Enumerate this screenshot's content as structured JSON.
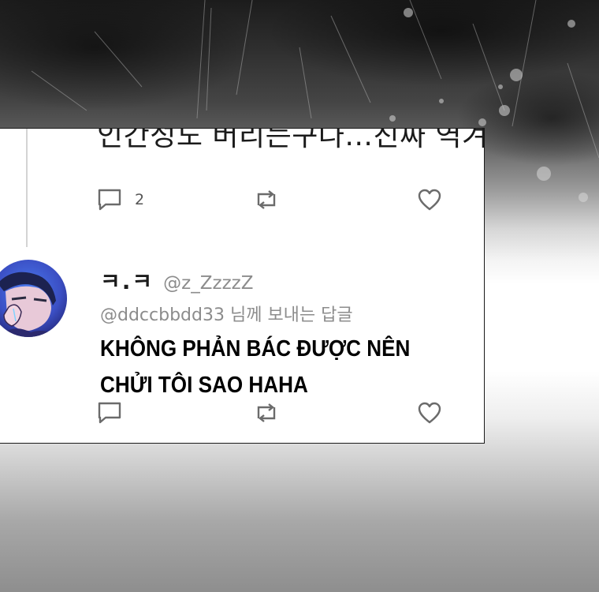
{
  "thread": {
    "previous_tweet": {
      "text_fragment": "인간성도 버리는구나...진짜 역겨",
      "reply_count": "2",
      "icons": {
        "reply": "reply-icon",
        "retweet": "retweet-icon",
        "like": "heart-icon"
      }
    },
    "reply_tweet": {
      "display_name": "ㅋ.ㅋ",
      "handle": "@z_ZzzzZ",
      "replying_to": "@ddccbbdd33 님께 보내는 답글",
      "text": "KHÔNG PHẢN BÁC ĐƯỢC NÊN CHỬI TÔI SAO HAHA",
      "icons": {
        "reply": "reply-icon",
        "retweet": "retweet-icon",
        "like": "heart-icon"
      }
    }
  },
  "colors": {
    "card_background": "#ffffff",
    "card_border": "#1a1a1a",
    "muted_text": "#8c8c8c",
    "icon": "#6b6b6b",
    "thread_line": "#d4d4d4"
  }
}
